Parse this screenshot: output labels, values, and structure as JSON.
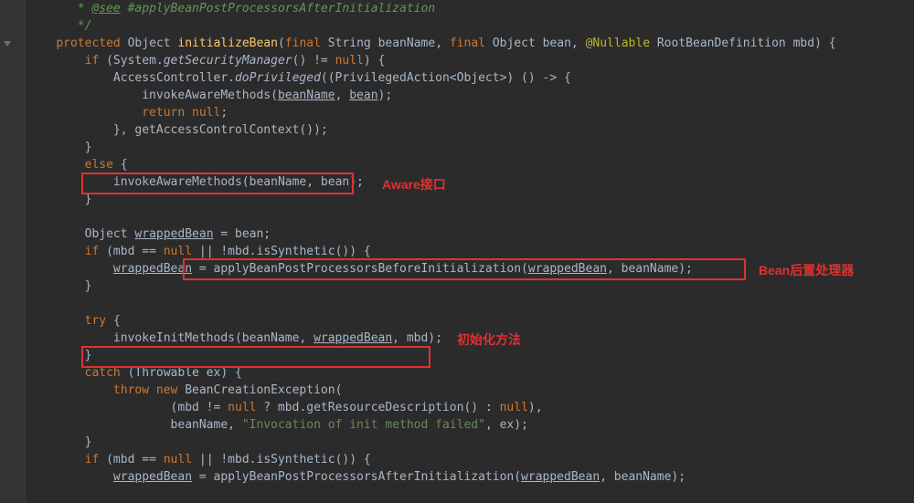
{
  "comment": {
    "see_tag": " * ",
    "see_prefix": "@see",
    "see_rest": " #applyBeanPostProcessorsAfterInitialization",
    "close": " */"
  },
  "sig": {
    "protected": "protected ",
    "ret": "Object ",
    "name": "initializeBean",
    "p_open": "(",
    "final1": "final ",
    "t_string": "String ",
    "a_beanName": "beanName",
    "comma1": ", ",
    "final2": "final ",
    "t_object": "Object ",
    "a_bean": "bean",
    "comma2": ", ",
    "anno": "@Nullable ",
    "t_rbd": "RootBeanDefinition ",
    "a_mbd": "mbd",
    "p_close": ") {"
  },
  "l": {
    "if_sec": "if ",
    "if_sec_cond": "(System.",
    "if_sec_call": "getSecurityManager",
    "if_sec_rest": "() != ",
    "null": "null",
    "if_sec_end": ") {",
    "ac_prefix": "AccessController.",
    "ac_method": "doPrivileged",
    "ac_args": "((PrivilegedAction<Object>) () -> {",
    "invoke_aware": "invokeAwareMethods(",
    "bn_u": "beanName",
    "bn": "beanName",
    "bean_u": "bean",
    "bean": "bean",
    "close_pc": ");",
    "return": "return ",
    "semi": ";",
    "close_lambda": "}, getAccessControlContext());",
    "brace_close": "}",
    "else": "else ",
    "else_open": "{",
    "obj": "Object ",
    "wrapped_u": "wrappedBean",
    "eq_bean": " = bean;",
    "if_mbd": "if ",
    "if_mbd_open": "(mbd == ",
    "if_mbd_rest": " || !mbd.isSynthetic()) {",
    "wrapped_assign": " = ",
    "apply_before": "applyBeanPostProcessorsBeforeInitialization(",
    "apply_before_sep": ", beanName);",
    "try": "try ",
    "try_open": "{",
    "invoke_init": "invokeInitMethods(beanName, ",
    "invoke_init_rest": ", mbd);",
    "catch": "catch ",
    "catch_args": "(Throwable ex) {",
    "throw": "throw ",
    "new": "new ",
    "bce": "BeanCreationException(",
    "bce_l1": "(mbd != ",
    "bce_l1b": " ? mbd.getResourceDescription() : ",
    "bce_l1c": "),",
    "bce_l2a": "beanName, ",
    "bce_str": "\"Invocation of init method failed\"",
    "bce_l2b": ", ex);",
    "apply_after": "applyBeanPostProcessorsAfterInitialization(",
    "apply_after_rest": ", beanName);"
  },
  "annotations": {
    "label1": "Aware接口",
    "label2": "Bean后置处理器",
    "label3": "初始化方法"
  }
}
